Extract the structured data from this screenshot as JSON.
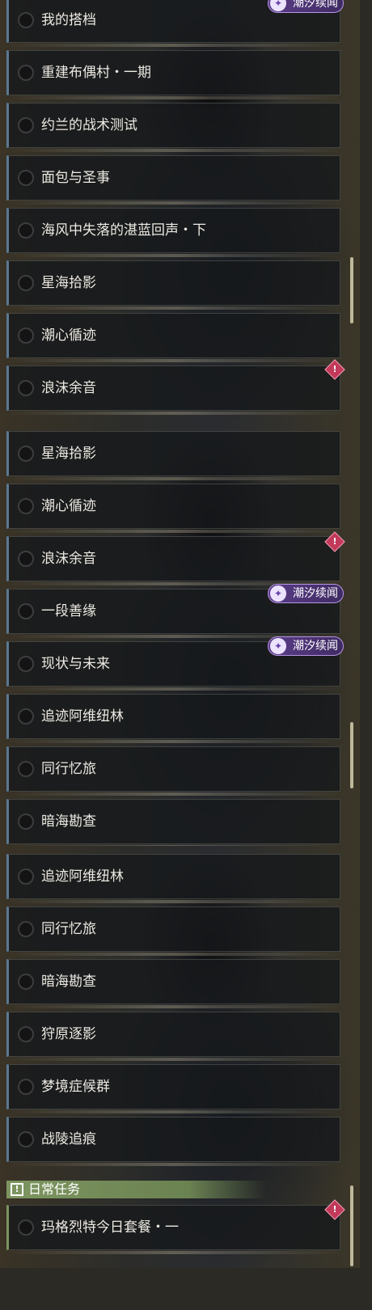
{
  "colors": {
    "row_accent": "#5b7892",
    "badge_purple": "#5a3d88",
    "alert_red": "#c2395a",
    "section_green": "#7d9560",
    "scrollbar": "#bfb99a"
  },
  "panel1": {
    "items": [
      {
        "label": "我的搭档"
      },
      {
        "label": "重建布偶村・一期"
      },
      {
        "label": "约兰的战术测试"
      },
      {
        "label": "面包与圣事"
      },
      {
        "label": "海风中失落的湛蓝回声・下"
      },
      {
        "label": "星海拾影"
      },
      {
        "label": "潮心循迹"
      },
      {
        "label": "浪沫余音"
      }
    ],
    "badge": {
      "label": "潮汐续闻",
      "icon": "swirl-emblem-icon"
    },
    "alert_icon": "alert-diamond-icon"
  },
  "panel2": {
    "items": [
      {
        "label": "星海拾影"
      },
      {
        "label": "潮心循迹"
      },
      {
        "label": "浪沫余音"
      },
      {
        "label": "一段善缘"
      },
      {
        "label": "现状与未来"
      },
      {
        "label": "追迹阿维纽林"
      },
      {
        "label": "同行忆旅"
      },
      {
        "label": "暗海勘查"
      }
    ],
    "badges": [
      {
        "label": "潮汐续闻"
      },
      {
        "label": "潮汐续闻"
      }
    ]
  },
  "panel3": {
    "items": [
      {
        "label": "追迹阿维纽林"
      },
      {
        "label": "同行忆旅"
      },
      {
        "label": "暗海勘查"
      },
      {
        "label": "狩原逐影"
      },
      {
        "label": "梦境症候群"
      },
      {
        "label": "战陵追痕"
      }
    ],
    "section": {
      "title": "日常任务",
      "icon": "exclamation-box-icon"
    },
    "daily_items": [
      {
        "label": "玛格烈特今日套餐・一"
      }
    ]
  }
}
